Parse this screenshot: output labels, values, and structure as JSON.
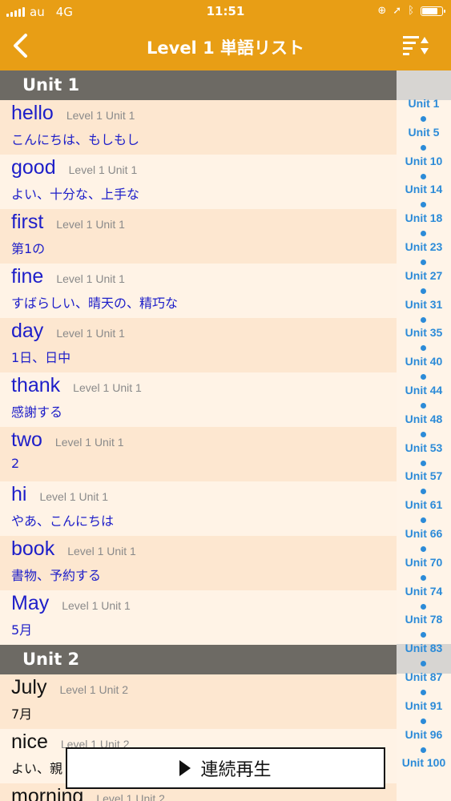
{
  "status_bar": {
    "carrier": "au",
    "network": "4G",
    "time": "11:51"
  },
  "nav": {
    "title": "Level 1  単語リスト",
    "back_icon": "chevron-left-icon",
    "sort_icon": "sort-icon"
  },
  "sections": [
    {
      "title": "Unit 1",
      "rows": [
        {
          "word": "hello",
          "tag": "Level 1 Unit 1",
          "meaning": "こんにちは、もしもし"
        },
        {
          "word": "good",
          "tag": "Level 1 Unit 1",
          "meaning": "よい、十分な、上手な"
        },
        {
          "word": "first",
          "tag": "Level 1 Unit 1",
          "meaning": "第1の"
        },
        {
          "word": "fine",
          "tag": "Level 1 Unit 1",
          "meaning": "すばらしい、晴天の、精巧な"
        },
        {
          "word": "day",
          "tag": "Level 1 Unit 1",
          "meaning": "1日、日中"
        },
        {
          "word": "thank",
          "tag": "Level 1 Unit 1",
          "meaning": "感謝する"
        },
        {
          "word": "two",
          "tag": "Level 1 Unit 1",
          "meaning": "2"
        },
        {
          "word": "hi",
          "tag": "Level 1 Unit 1",
          "meaning": "やあ、こんにちは"
        },
        {
          "word": "book",
          "tag": "Level 1 Unit 1",
          "meaning": "書物、予約する"
        },
        {
          "word": "May",
          "tag": "Level 1 Unit 1",
          "meaning": "5月"
        }
      ]
    },
    {
      "title": "Unit 2",
      "rows": [
        {
          "word": "July",
          "tag": "Level 1 Unit 2",
          "meaning": "7月"
        },
        {
          "word": "nice",
          "tag": "Level 1 Unit 2",
          "meaning": "よい、親"
        },
        {
          "word": "morning",
          "tag": "Level 1 Unit 2",
          "meaning": ""
        }
      ]
    }
  ],
  "index": [
    "Unit 1",
    "Unit 5",
    "Unit 10",
    "Unit 14",
    "Unit 18",
    "Unit 23",
    "Unit 27",
    "Unit 31",
    "Unit 35",
    "Unit 40",
    "Unit 44",
    "Unit 48",
    "Unit 53",
    "Unit 57",
    "Unit 61",
    "Unit 66",
    "Unit 70",
    "Unit 74",
    "Unit 78",
    "Unit 83",
    "Unit 87",
    "Unit 91",
    "Unit 96",
    "Unit 100"
  ],
  "play_button": {
    "label": "連続再生",
    "icon": "play-icon"
  },
  "colors": {
    "accent": "#e89e15",
    "word": "#1d1ec9",
    "index": "#2c8bd8",
    "section": "#6d6a64"
  }
}
